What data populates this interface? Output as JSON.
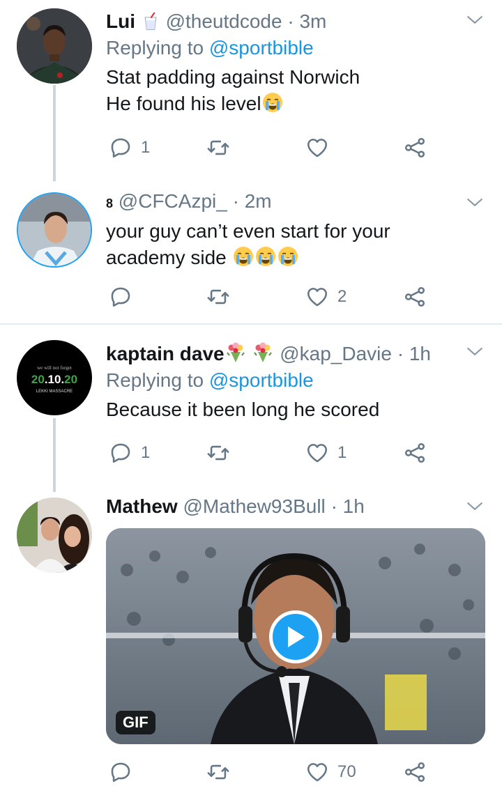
{
  "colors": {
    "accent": "#1b95e0",
    "muted": "#657786",
    "text": "#14171a",
    "divider": "#e6ecf0",
    "play": "#1da1f2"
  },
  "tweets": [
    {
      "name": "Lui",
      "handle": "@theutdcode",
      "time": "· 3m",
      "replying_prefix": "Replying to",
      "replying_to": "@sportbible",
      "body_line1": "Stat padding against Norwich",
      "body_line2": "He found his level",
      "reply_count": "1",
      "retweet_count": "",
      "like_count": ""
    },
    {
      "name": "8",
      "handle": "@CFCAzpi_",
      "time": "· 2m",
      "body_line1": "your guy can’t even start for your",
      "body_line2": "academy side",
      "reply_count": "",
      "retweet_count": "",
      "like_count": "2"
    },
    {
      "name": "kaptain dave",
      "handle": "@kap_Davie",
      "time": "· 1h",
      "replying_prefix": "Replying to",
      "replying_to": "@sportbible",
      "body_line1": "Because it been long he scored",
      "avatar_text_top": "we will not forget",
      "avatar_date_a": "20",
      "avatar_date_b": ".10.",
      "avatar_date_c": "20",
      "avatar_text_bottom": "LEKKI MASSACRE",
      "reply_count": "1",
      "retweet_count": "",
      "like_count": "1"
    },
    {
      "name": "Mathew",
      "handle": "@Mathew93Bull",
      "time": "· 1h",
      "media_badge": "GIF",
      "reply_count": "",
      "retweet_count": "",
      "like_count": "70"
    }
  ],
  "icons": [
    "chevron-down-icon",
    "reply-icon",
    "retweet-icon",
    "like-icon",
    "share-icon",
    "play-icon",
    "crying-emoji",
    "bouquet-emoji",
    "cup-emoji"
  ]
}
